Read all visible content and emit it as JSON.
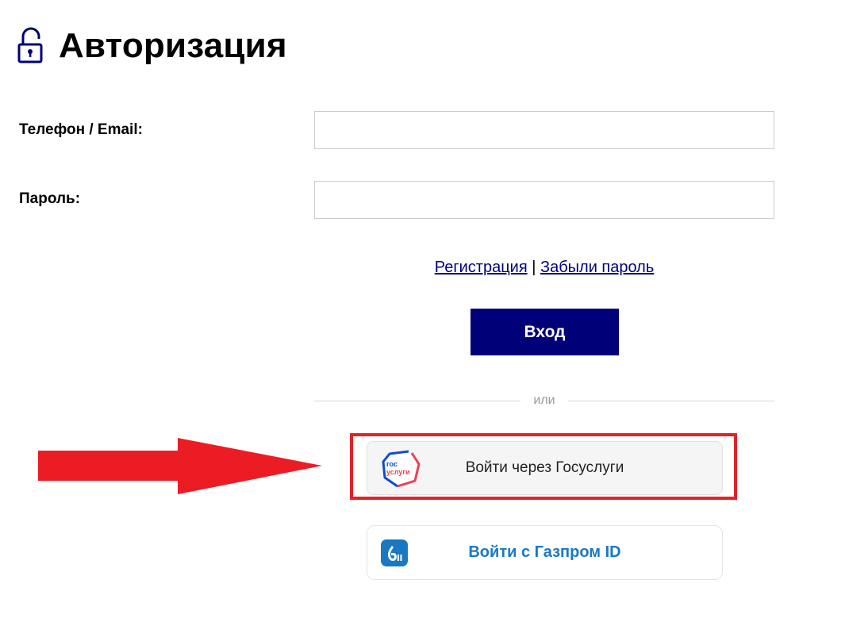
{
  "page": {
    "title": "Авторизация",
    "lock_icon": "unlock-icon"
  },
  "form": {
    "phone_label": "Телефон / Email:",
    "phone_value": "",
    "password_label": "Пароль:",
    "password_value": ""
  },
  "links": {
    "register": "Регистрация",
    "separator": "|",
    "forgot": "Забыли пароль"
  },
  "login_button": {
    "label": "Вход"
  },
  "divider": {
    "text": "или"
  },
  "gosuslugi": {
    "label": "Войти через Госуслуги",
    "logo_line1": "гос",
    "logo_line2": "услуги",
    "icon": "gosuslugi-logo-icon"
  },
  "gazprom": {
    "label": "Войти с Газпром ID",
    "icon": "gazprom-id-logo-icon"
  },
  "annotation": {
    "arrow_icon": "red-arrow-icon",
    "highlight_color": "#e32228"
  },
  "colors": {
    "primary": "#000078",
    "link": "#000080",
    "gazprom_blue": "#1a78c2"
  }
}
